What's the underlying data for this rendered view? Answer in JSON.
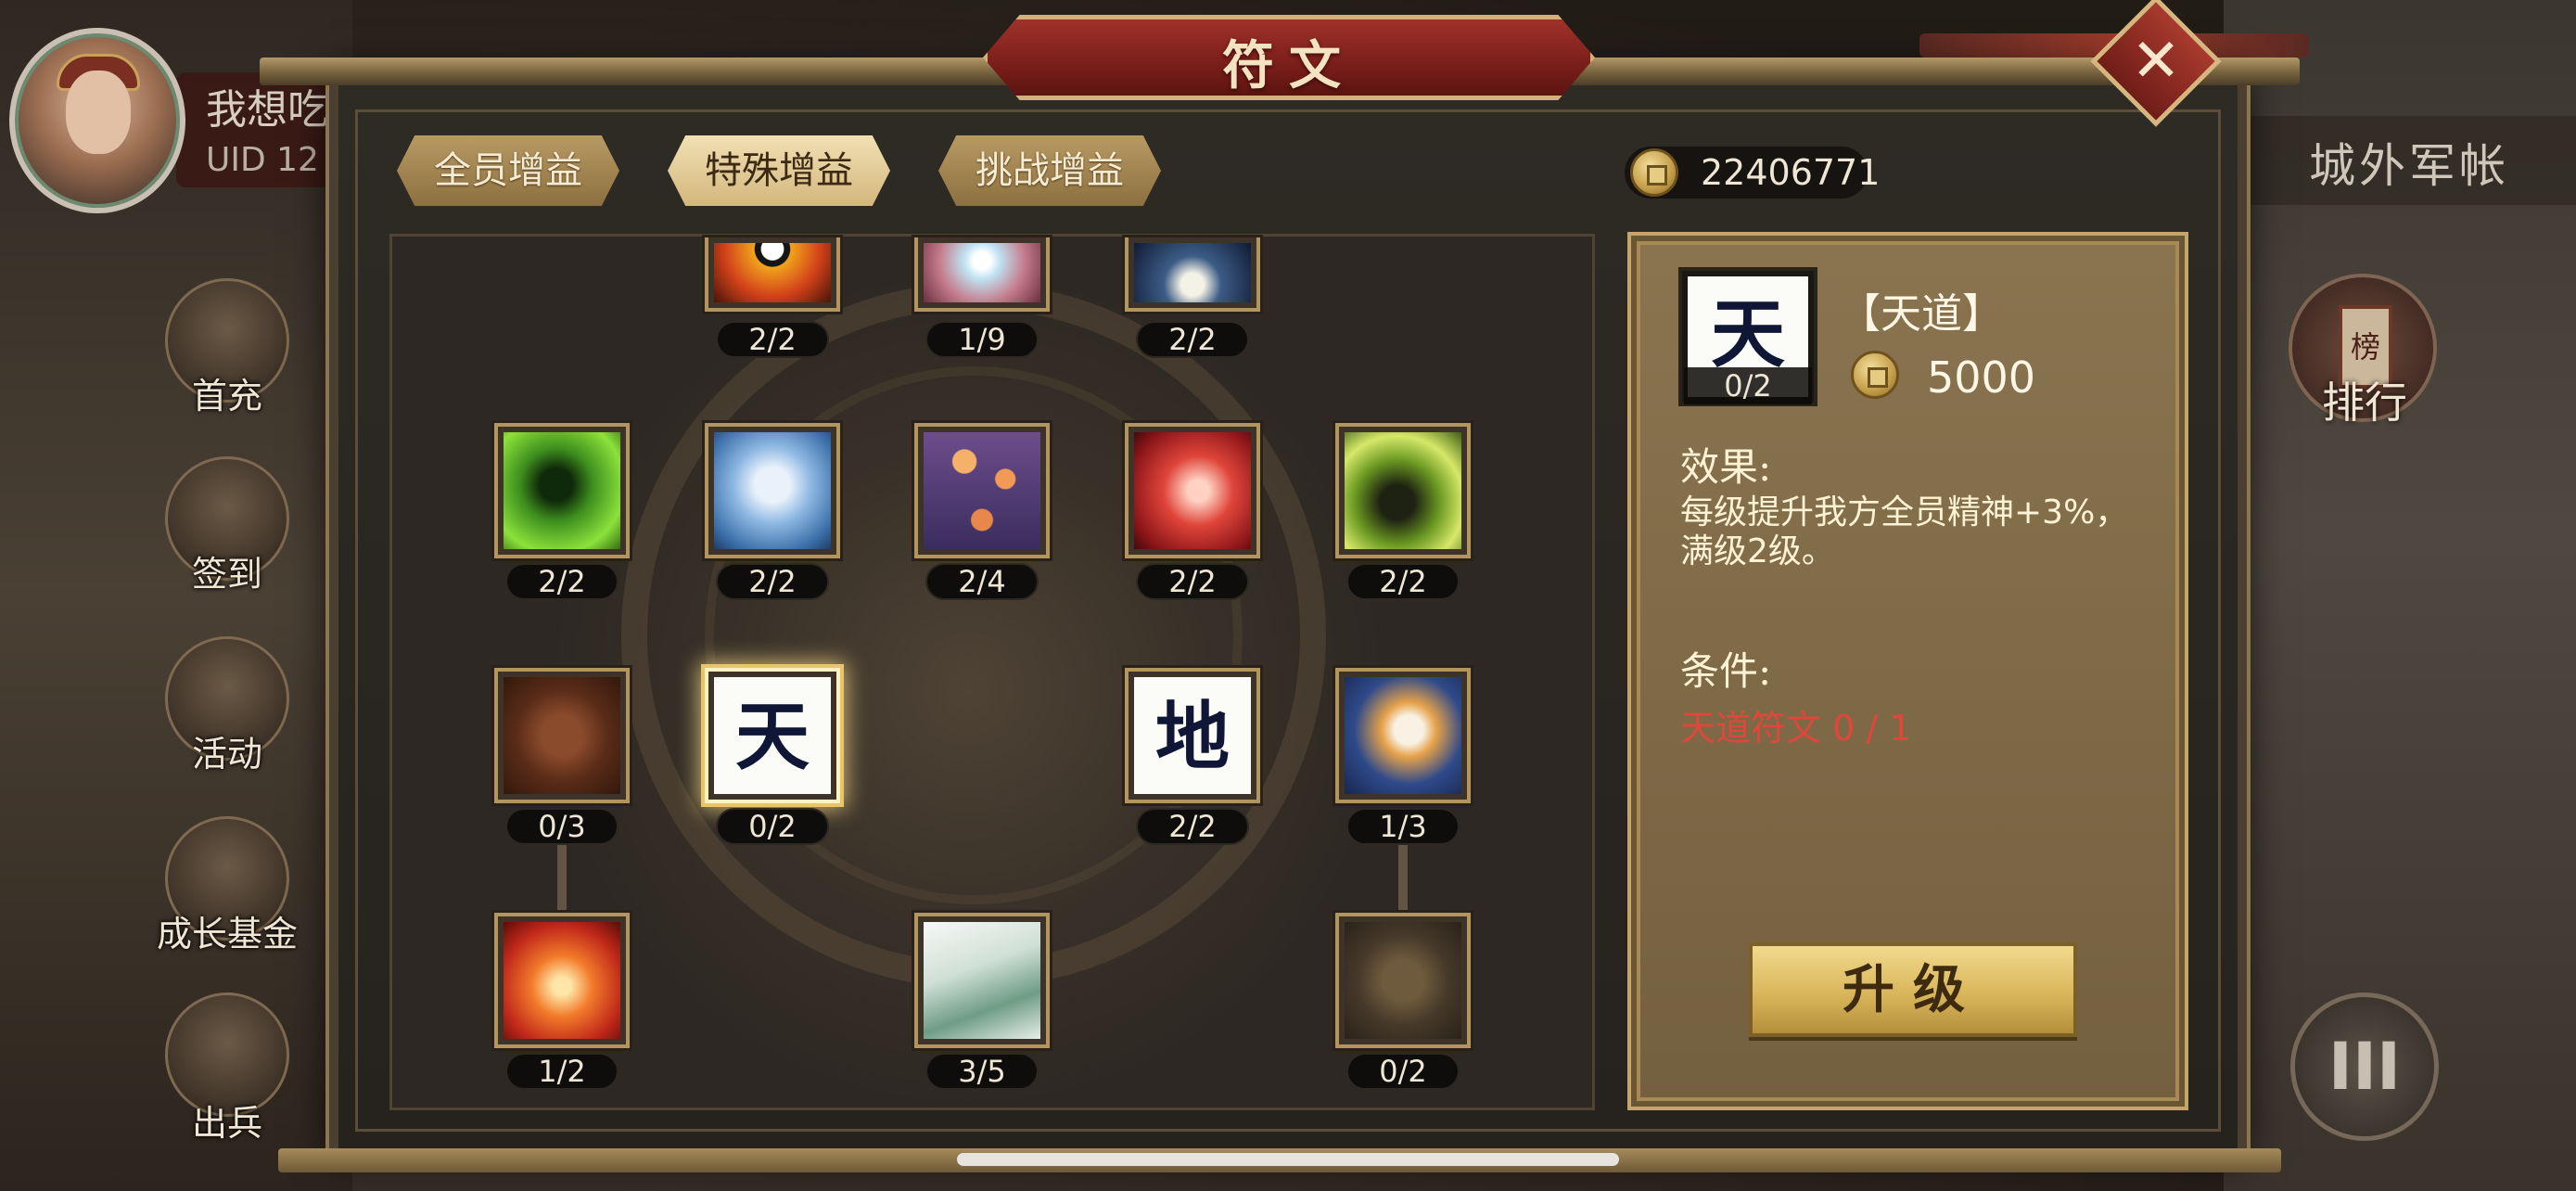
{
  "title": "符文",
  "player": {
    "name": "我想吃",
    "uid": "UID  12"
  },
  "side_menu": [
    {
      "label": "首充"
    },
    {
      "label": "签到"
    },
    {
      "label": "活动"
    },
    {
      "label": "成长基金"
    },
    {
      "label": "出兵"
    }
  ],
  "right_hud": {
    "camp": "城外军帐",
    "rank": "排行",
    "rank_plaque": "榜",
    "menu_icon": "three-bars-icon"
  },
  "tabs": [
    {
      "label": "全员增益",
      "active": false
    },
    {
      "label": "特殊增益",
      "active": true
    },
    {
      "label": "挑战增益",
      "active": false
    }
  ],
  "currency": {
    "icon": "coin-icon",
    "value": "22406771"
  },
  "runes": [
    {
      "level": "2/2",
      "art": "flame-mask"
    },
    {
      "level": "1/9",
      "art": "white-light"
    },
    {
      "level": "2/2",
      "art": "blue-crane"
    },
    {
      "level": "2/2",
      "art": "green-dragon"
    },
    {
      "level": "2/2",
      "art": "white-tiger"
    },
    {
      "level": "2/4",
      "art": "lanterns"
    },
    {
      "level": "2/2",
      "art": "red-fox"
    },
    {
      "level": "2/2",
      "art": "green-cannon"
    },
    {
      "level": "0/3",
      "art": "locked-cloud"
    },
    {
      "level": "0/2",
      "art": "glyph",
      "glyph": "天"
    },
    {
      "level": "2/2",
      "art": "glyph",
      "glyph": "地"
    },
    {
      "level": "1/3",
      "art": "moon-rabbit"
    },
    {
      "level": "1/2",
      "art": "phoenix"
    },
    {
      "level": "3/5",
      "art": "mountains"
    },
    {
      "level": "0/2",
      "art": "locked-cloud"
    }
  ],
  "detail": {
    "glyph": "天",
    "level": "0/2",
    "name": "【天道】",
    "cost": "5000",
    "effect_label": "效果:",
    "effect": "每级提升我方全员精神+3%，满级2级。",
    "condition_label": "条件:",
    "condition": "天道符文 0 / 1",
    "upgrade_label": "升级"
  },
  "colors": {
    "panel_bg": "#2e2a24",
    "title_red": "#8a2520",
    "gold": "#d3b27a",
    "detail_bg": "#7d6846",
    "condition_red": "#e0473a"
  }
}
